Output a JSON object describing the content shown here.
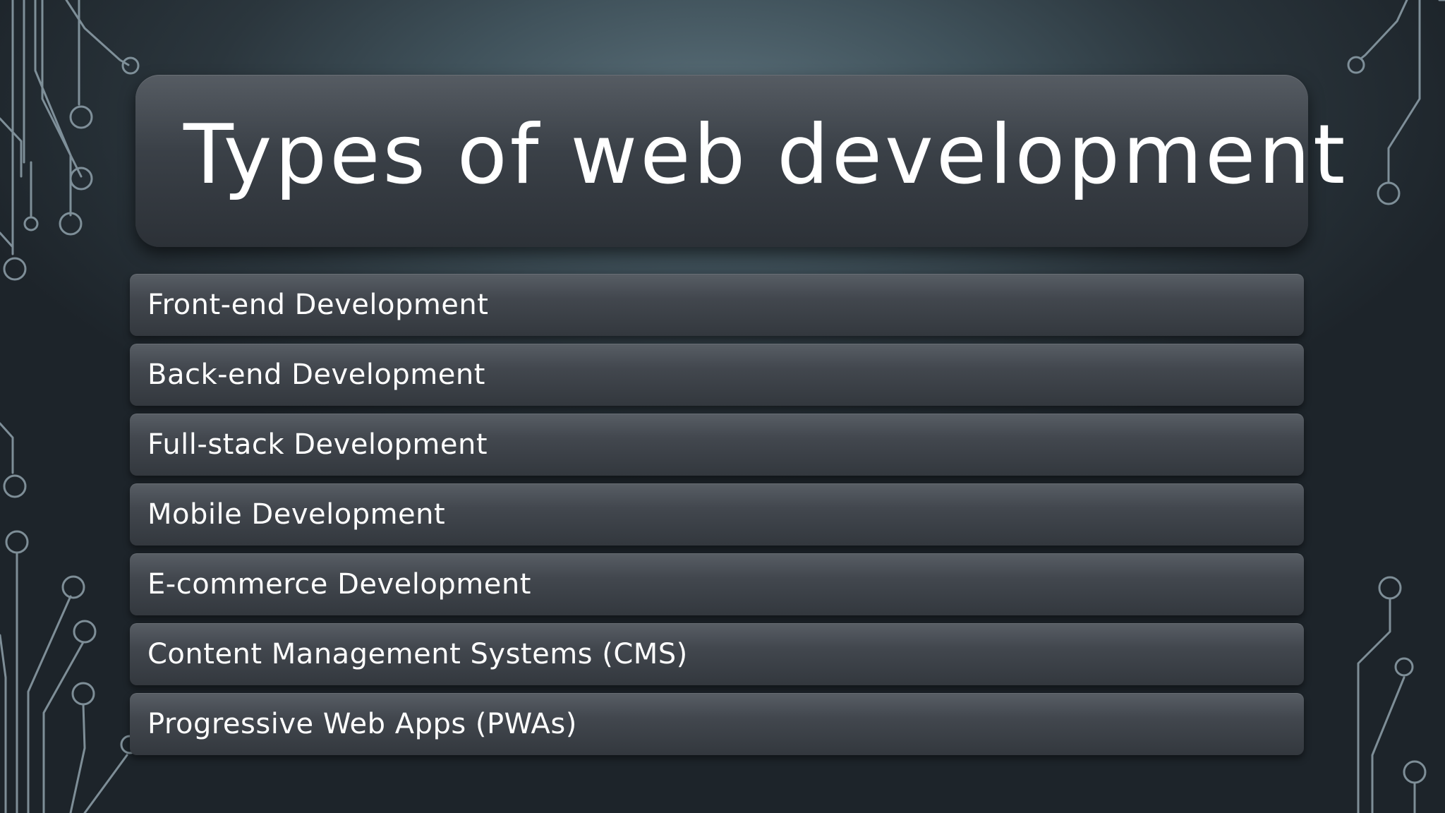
{
  "slide": {
    "title": "Types of web development",
    "items": [
      {
        "label": "Front-end Development"
      },
      {
        "label": "Back-end Development"
      },
      {
        "label": "Full-stack Development"
      },
      {
        "label": "Mobile Development"
      },
      {
        "label": "E-commerce Development"
      },
      {
        "label": "Content Management Systems (CMS)"
      },
      {
        "label": "Progressive Web Apps (PWAs)"
      }
    ]
  },
  "colors": {
    "background": "#2b363d",
    "panel": "#3a4047",
    "text": "#ffffff",
    "circuit_lines": "#8fa1ab"
  },
  "icons": [
    "circuit-decoration-left",
    "circuit-decoration-right"
  ]
}
